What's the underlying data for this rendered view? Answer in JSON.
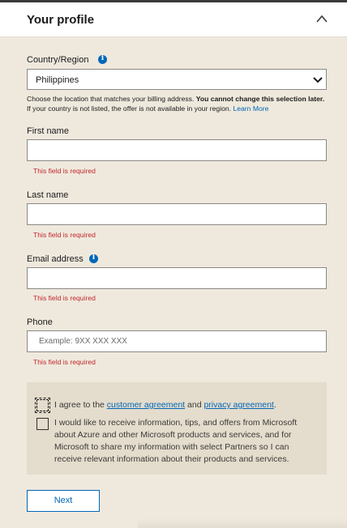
{
  "header": {
    "title": "Your profile",
    "collapse_icon": "chevron-up-icon"
  },
  "country": {
    "label": "Country/Region",
    "value": "Philippines",
    "note_pre": "Choose the location that matches your billing address. ",
    "note_bold": "You cannot change this selection later.",
    "note_post": " If your country is not listed, the offer is not available in your region. ",
    "note_link": "Learn More"
  },
  "first_name": {
    "label": "First name",
    "value": "",
    "error": "This field is required"
  },
  "last_name": {
    "label": "Last name",
    "value": "",
    "error": "This field is required"
  },
  "email": {
    "label": "Email address",
    "value": "",
    "error": "This field is required"
  },
  "phone": {
    "label": "Phone",
    "placeholder": "Example: 9XX XXX XXX",
    "error": "This field is required"
  },
  "consent": {
    "agree_pre": "I agree to the ",
    "agree_link1": "customer agreement",
    "agree_mid": " and ",
    "agree_link2": "privacy agreement",
    "agree_post": ".",
    "marketing_text": "I would like to receive information, tips, and offers from Microsoft about Azure and other Microsoft products and services, and for Microsoft to share my information with select Partners so I can receive relevant information about their products and services."
  },
  "actions": {
    "next_label": "Next"
  },
  "colors": {
    "accent": "#0067b8",
    "error": "#c4262e",
    "background": "#efe9dd"
  }
}
